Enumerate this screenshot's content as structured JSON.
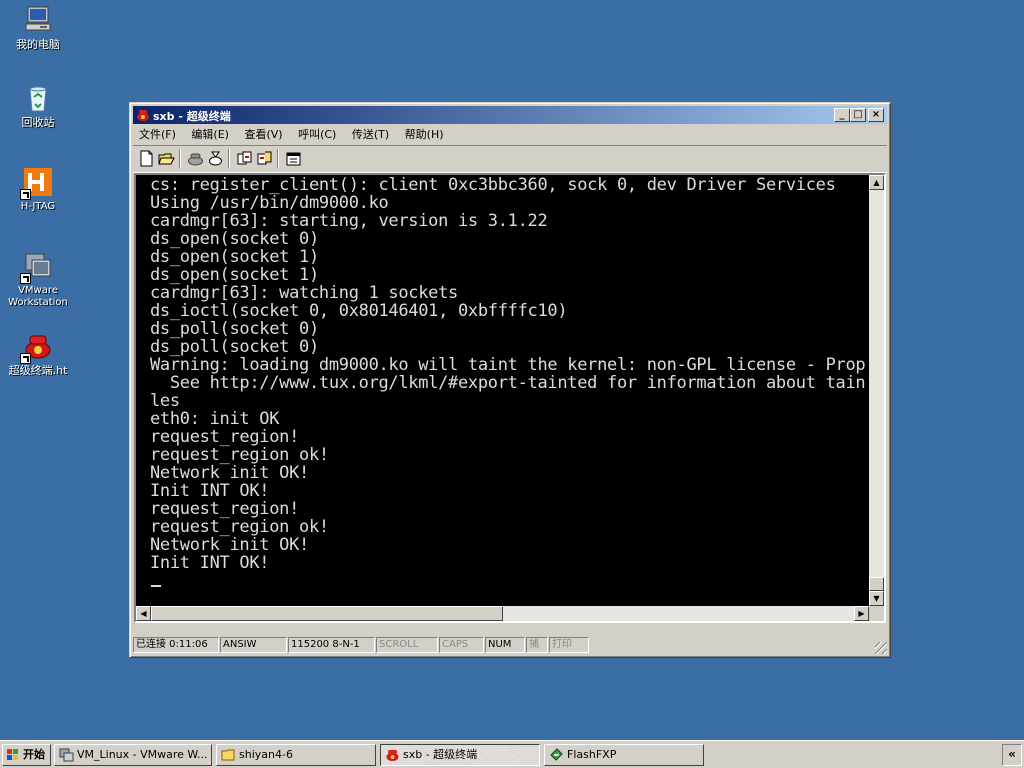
{
  "desktop": {
    "background": "#3a6ea5",
    "icons": [
      {
        "label": "我的电脑",
        "icon": "my-computer-icon"
      },
      {
        "label": "回收站",
        "icon": "recycle-bin-icon"
      },
      {
        "label": "H-JTAG",
        "icon": "h-jtag-icon"
      },
      {
        "label": "VMware Workstation",
        "icon": "vmware-icon"
      },
      {
        "label": "超级终端.ht",
        "icon": "hyperterminal-icon"
      }
    ]
  },
  "window": {
    "title": "sxb - 超级终端",
    "controls": {
      "minimize": "_",
      "maximize": "□",
      "close": "×"
    },
    "menu": [
      "文件(F)",
      "编辑(E)",
      "查看(V)",
      "呼叫(C)",
      "传送(T)",
      "帮助(H)"
    ],
    "toolbar": [
      "new-file-icon",
      "open-folder-icon",
      "dial-icon",
      "disconnect-icon",
      "send-file-icon",
      "receive-file-icon",
      "properties-icon"
    ],
    "terminal": {
      "lines": [
        "cs: register_client(): client 0xc3bbc360, sock 0, dev Driver Services",
        "Using /usr/bin/dm9000.ko",
        "cardmgr[63]: starting, version is 3.1.22",
        "ds_open(socket 0)",
        "ds_open(socket 1)",
        "ds_open(socket 1)",
        "cardmgr[63]: watching 1 sockets",
        "ds_ioctl(socket 0, 0x80146401, 0xbffffc10)",
        "ds_poll(socket 0)",
        "ds_poll(socket 0)",
        "Warning: loading dm9000.ko will taint the kernel: non-GPL license - Prop",
        "  See http://www.tux.org/lkml/#export-tainted for information about tain",
        "les",
        "eth0: init OK",
        "request_region!",
        "request_region ok!",
        "Network init OK!",
        "Init INT OK!",
        "request_region!",
        "request_region ok!",
        "Network init OK!",
        "Init INT OK!"
      ],
      "cursor": "_"
    },
    "status": {
      "connected": "已连接 0:11:06",
      "emulation": "ANSIW",
      "port": "115200 8-N-1",
      "scroll": "SCROLL",
      "caps": "CAPS",
      "num": "NUM",
      "capture": "捕",
      "print": "打印"
    }
  },
  "taskbar": {
    "start_label": "开始",
    "tasks": [
      {
        "label": "VM_Linux - VMware W...",
        "icon": "vmware-icon",
        "active": false
      },
      {
        "label": "shiyan4-6",
        "icon": "folder-icon",
        "active": false
      },
      {
        "label": "sxb - 超级终端",
        "icon": "hyperterminal-icon",
        "active": true
      },
      {
        "label": "FlashFXP",
        "icon": "flashfxp-icon",
        "active": false
      }
    ],
    "tray_label": "«"
  }
}
